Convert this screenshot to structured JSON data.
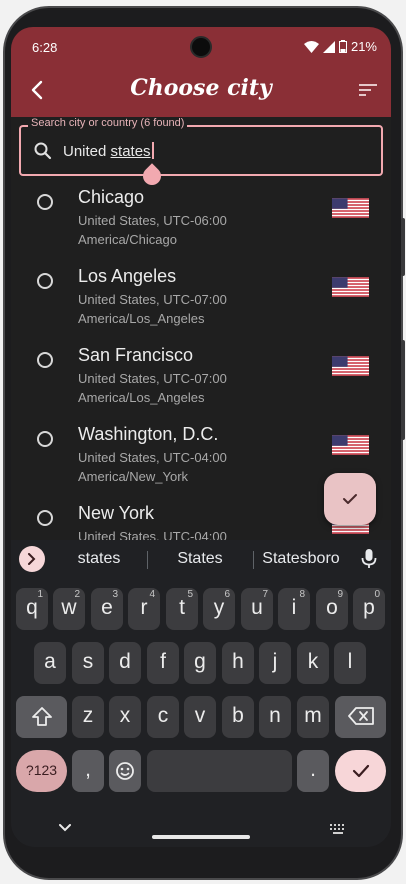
{
  "status": {
    "time": "6:28",
    "battery": "21%"
  },
  "app_bar": {
    "title": "Choose city"
  },
  "search": {
    "label": "Search city or country (6 found)",
    "value_plain": "United ",
    "value_underlined": "states"
  },
  "cities": [
    {
      "name": "Chicago",
      "country_offset": "United States, UTC-06:00",
      "timezone": "America/Chicago"
    },
    {
      "name": "Los Angeles",
      "country_offset": "United States, UTC-07:00",
      "timezone": "America/Los_Angeles"
    },
    {
      "name": "San Francisco",
      "country_offset": "United States, UTC-07:00",
      "timezone": "America/Los_Angeles"
    },
    {
      "name": "Washington, D.C.",
      "country_offset": "United States, UTC-04:00",
      "timezone": "America/New_York"
    },
    {
      "name": "New York",
      "country_offset": "United States, UTC-04:00",
      "timezone": ""
    }
  ],
  "keyboard": {
    "suggestions": [
      "states",
      "States",
      "Statesboro"
    ],
    "row1": [
      {
        "k": "q",
        "h": "1"
      },
      {
        "k": "w",
        "h": "2"
      },
      {
        "k": "e",
        "h": "3"
      },
      {
        "k": "r",
        "h": "4"
      },
      {
        "k": "t",
        "h": "5"
      },
      {
        "k": "y",
        "h": "6"
      },
      {
        "k": "u",
        "h": "7"
      },
      {
        "k": "i",
        "h": "8"
      },
      {
        "k": "o",
        "h": "9"
      },
      {
        "k": "p",
        "h": "0"
      }
    ],
    "row2": [
      "a",
      "s",
      "d",
      "f",
      "g",
      "h",
      "j",
      "k",
      "l"
    ],
    "row3": [
      "z",
      "x",
      "c",
      "v",
      "b",
      "n",
      "m"
    ],
    "symbols_label": "?123",
    "comma": ",",
    "period": "."
  },
  "colors": {
    "app_bar": "#8a2f36",
    "accent": "#f2a9b0",
    "background": "#1f1f1f"
  },
  "icons": [
    "back-arrow-icon",
    "sort-icon",
    "search-icon",
    "us-flag-icon",
    "check-icon",
    "mic-icon",
    "shift-icon",
    "backspace-icon",
    "emoji-icon",
    "keyboard-icon"
  ]
}
